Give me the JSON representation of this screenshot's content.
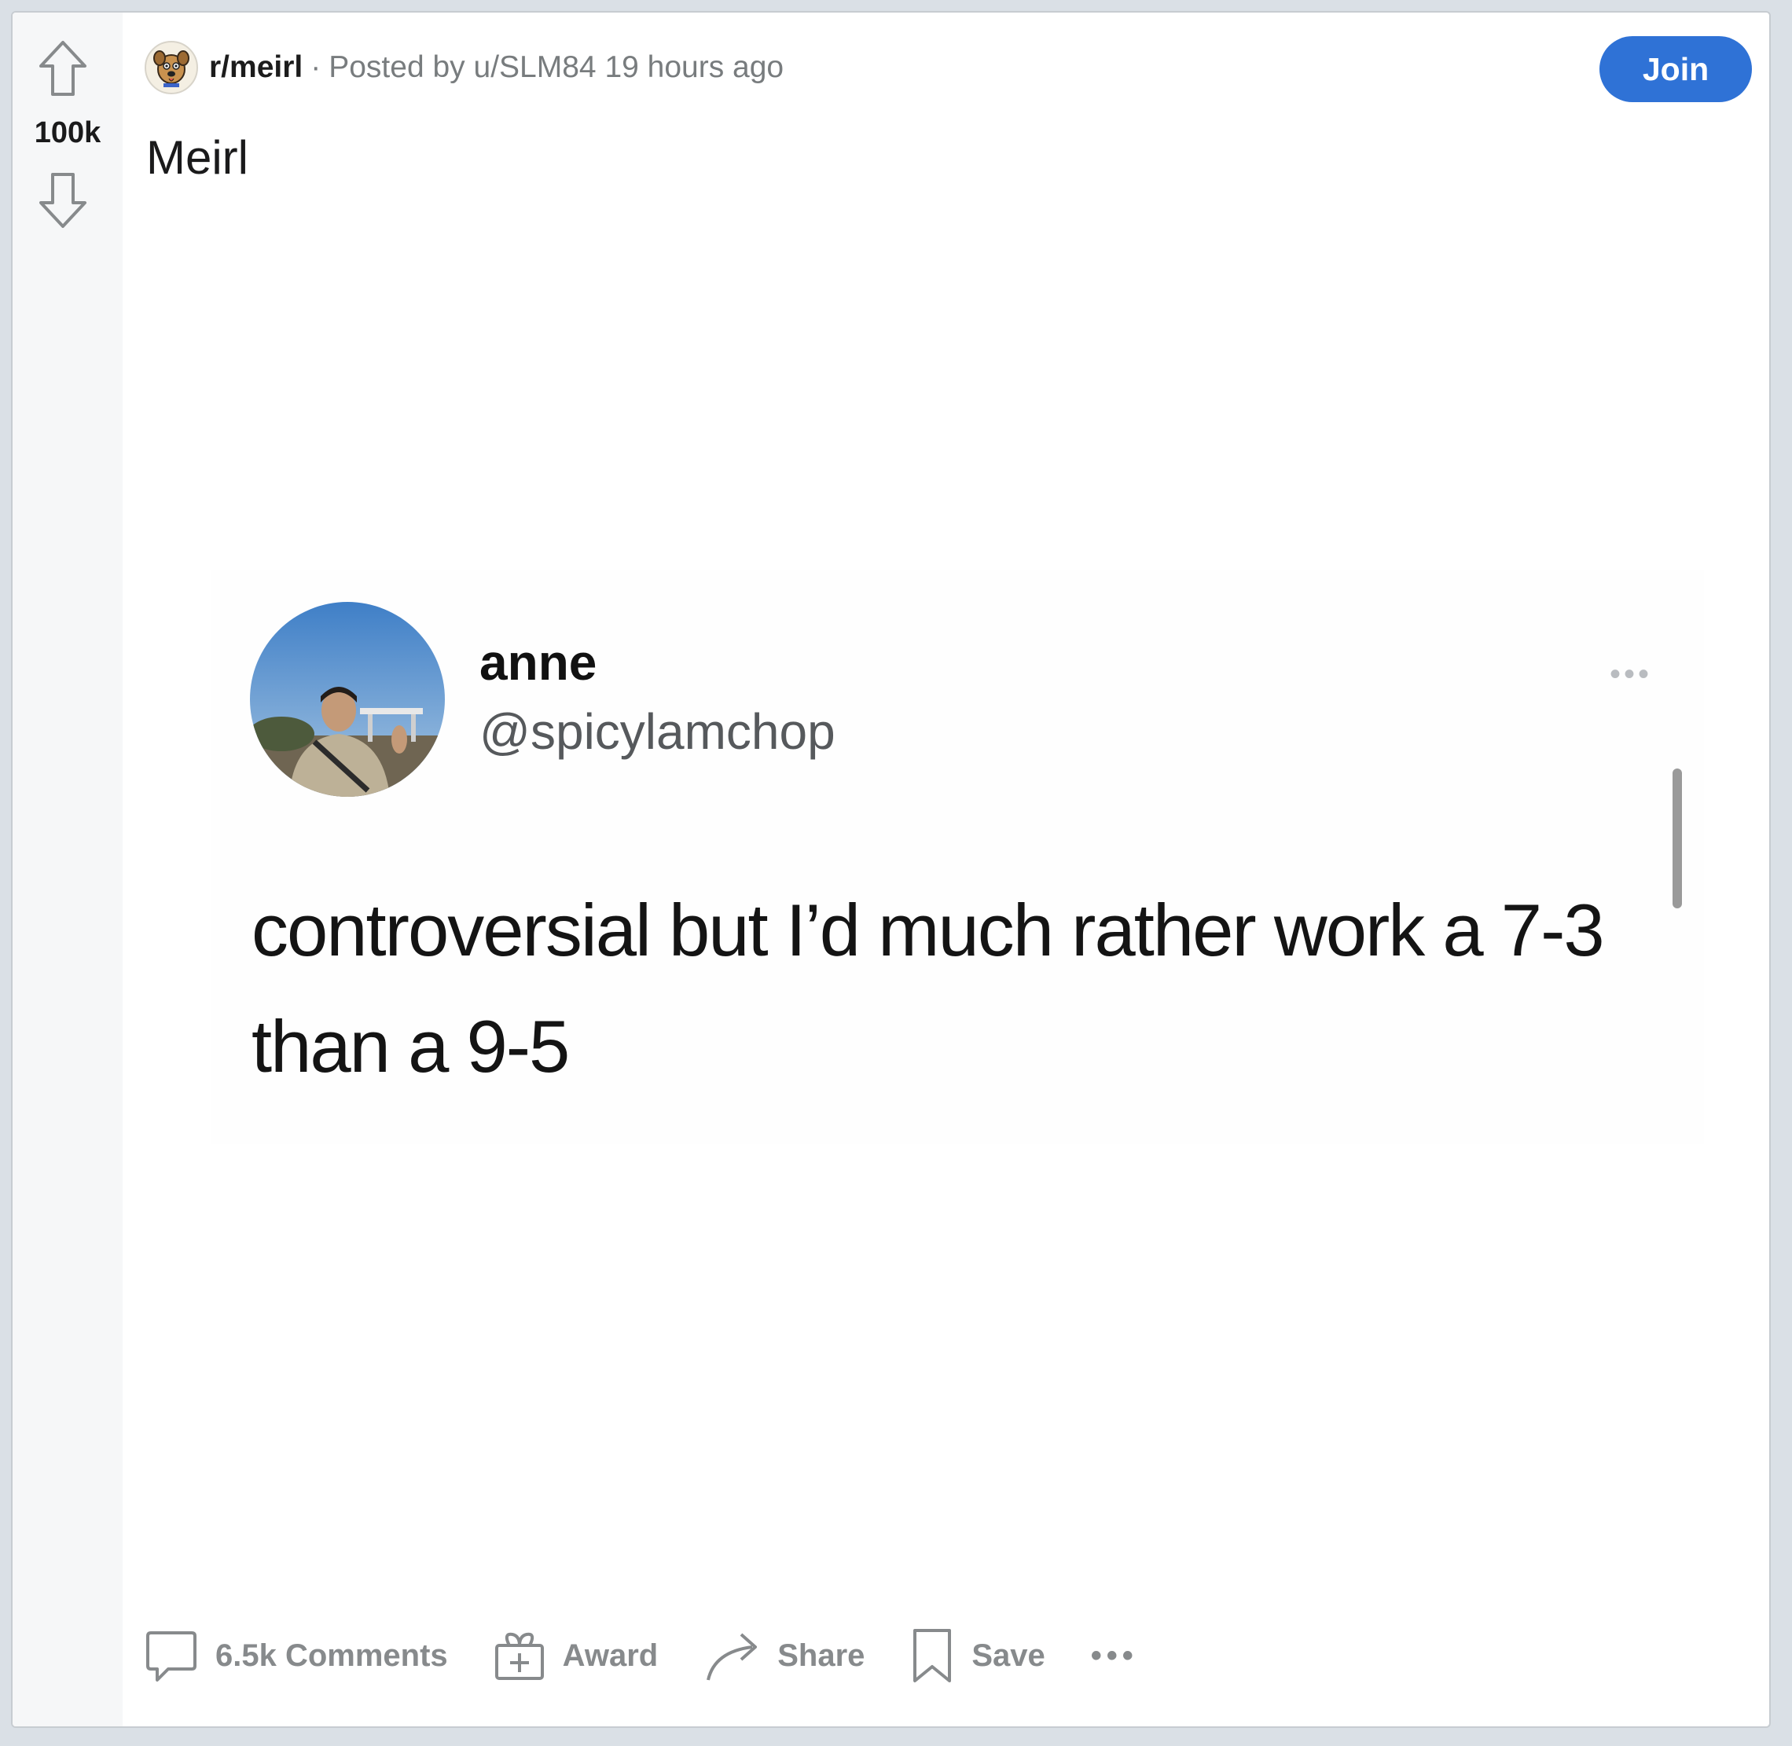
{
  "vote": {
    "score": "100k"
  },
  "meta": {
    "subreddit": "r/meirl",
    "separator": "·",
    "posted_by": "Posted by u/SLM84 19 hours ago"
  },
  "join_label": "Join",
  "post": {
    "title": "Meirl"
  },
  "tweet": {
    "name": "anne",
    "handle": "@spicylamchop",
    "more": "•••",
    "text": "controversial but I’d much rather work a 7-3 than a 9-5"
  },
  "actions": {
    "comments": "6.5k Comments",
    "award": "Award",
    "share": "Share",
    "save": "Save",
    "more": "•••"
  },
  "icons": {
    "upvote": "upvote-arrow-icon",
    "downvote": "downvote-arrow-icon",
    "comments": "comment-bubble-icon",
    "award": "gift-icon",
    "share": "share-arrow-icon",
    "save": "bookmark-icon"
  },
  "colors": {
    "join_button": "#2f72d6",
    "action_text": "#878a8c",
    "page_background": "#dae0e6"
  }
}
